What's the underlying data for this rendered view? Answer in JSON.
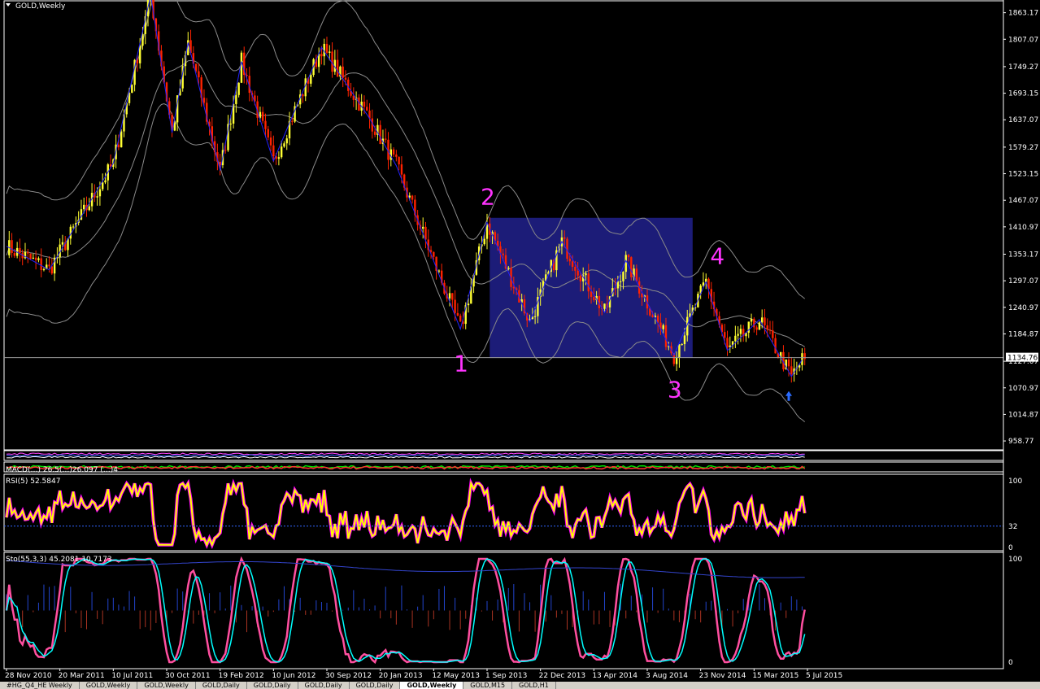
{
  "window": {
    "title": "GOLD,Weekly"
  },
  "colors": {
    "background": "#000000",
    "bull_candle": "#ffff33",
    "bear_candle": "#ff2200",
    "zigzag": "#2222ff",
    "bands": "#8a8a8a",
    "wave_labels": "#ff33ff",
    "box_fill": "#1c1c78",
    "rsi_line": "#ffff00",
    "rsi_glow": "#ff00ff",
    "stoch_main": "#ff4fa0",
    "stoch_signal": "#00ffff",
    "histogram_pos": "#2244cc",
    "histogram_neg": "#aa3322",
    "grid_text": "#ffffff"
  },
  "chart_data": [
    {
      "type": "candlestick",
      "title": "GOLD,Weekly",
      "ylim": [
        940,
        1890
      ],
      "y_ticks": [
        "1863.17",
        "1807.07",
        "1749.27",
        "1693.15",
        "1637.07",
        "1579.27",
        "1523.15",
        "1467.07",
        "1410.97",
        "1353.17",
        "1297.07",
        "1240.97",
        "1184.87",
        "1127.07",
        "1070.97",
        "1014.87",
        "958.77"
      ],
      "current_price": "1134.76",
      "x_ticks": [
        "28 Nov 2010",
        "20 Mar 2011",
        "10 Jul 2011",
        "30 Oct 2011",
        "19 Feb 2012",
        "10 Jun 2012",
        "30 Sep 2012",
        "20 Jan 2013",
        "12 May 2013",
        "1 Sep 2013",
        "22 Dec 2013",
        "13 Apr 2014",
        "3 Aug 2014",
        "23 Nov 2014",
        "15 Mar 2015",
        "5 Jul 2015"
      ],
      "price_path": [
        {
          "week": 0,
          "close": 1370
        },
        {
          "week": 16,
          "close": 1320
        },
        {
          "week": 40,
          "close": 1545
        },
        {
          "week": 54,
          "close": 1900
        },
        {
          "week": 62,
          "close": 1610
        },
        {
          "week": 68,
          "close": 1800
        },
        {
          "week": 80,
          "close": 1530
        },
        {
          "week": 88,
          "close": 1760
        },
        {
          "week": 100,
          "close": 1550
        },
        {
          "week": 118,
          "close": 1790
        },
        {
          "week": 136,
          "close": 1640
        },
        {
          "week": 146,
          "close": 1540
        },
        {
          "week": 170,
          "close": 1195
        },
        {
          "week": 180,
          "close": 1420
        },
        {
          "week": 196,
          "close": 1210
        },
        {
          "week": 208,
          "close": 1380
        },
        {
          "week": 224,
          "close": 1230
        },
        {
          "week": 232,
          "close": 1340
        },
        {
          "week": 250,
          "close": 1140
        },
        {
          "week": 262,
          "close": 1295
        },
        {
          "week": 270,
          "close": 1150
        },
        {
          "week": 282,
          "close": 1215
        },
        {
          "week": 294,
          "close": 1095
        },
        {
          "week": 298,
          "close": 1130
        }
      ],
      "wave_labels": [
        {
          "label": "1",
          "week": 170
        },
        {
          "label": "2",
          "week": 180
        },
        {
          "label": "3",
          "week": 250
        },
        {
          "label": "4",
          "week": 266
        }
      ],
      "highlight_box": {
        "week_from": 181,
        "week_to": 257,
        "price_from": 1134,
        "price_to": 1430
      }
    },
    {
      "type": "line",
      "title": "",
      "series": []
    },
    {
      "type": "line",
      "title": "MACD(…) 26.5(…)26.097 (…)4",
      "series": []
    },
    {
      "type": "line",
      "title": "RSI(5) 52.5847",
      "y_ticks": [
        "100",
        "32",
        "0"
      ],
      "levels": [
        32
      ]
    },
    {
      "type": "line",
      "title": "Sto(55,3,3) 45.2081 10.7173",
      "y_ticks": [
        "100",
        "0"
      ]
    }
  ],
  "tabs": [
    {
      "label": "#HG_Q4_HE Weekly"
    },
    {
      "label": "GOLD,Weekly"
    },
    {
      "label": "GOLD,Weekly"
    },
    {
      "label": "GOLD,Daily"
    },
    {
      "label": "GOLD,Daily"
    },
    {
      "label": "GOLD,Daily"
    },
    {
      "label": "GOLD,Daily"
    },
    {
      "label": "GOLD,Weekly"
    },
    {
      "label": "GOLD,M15"
    },
    {
      "label": "GOLD,H1"
    }
  ],
  "active_tab": 7
}
